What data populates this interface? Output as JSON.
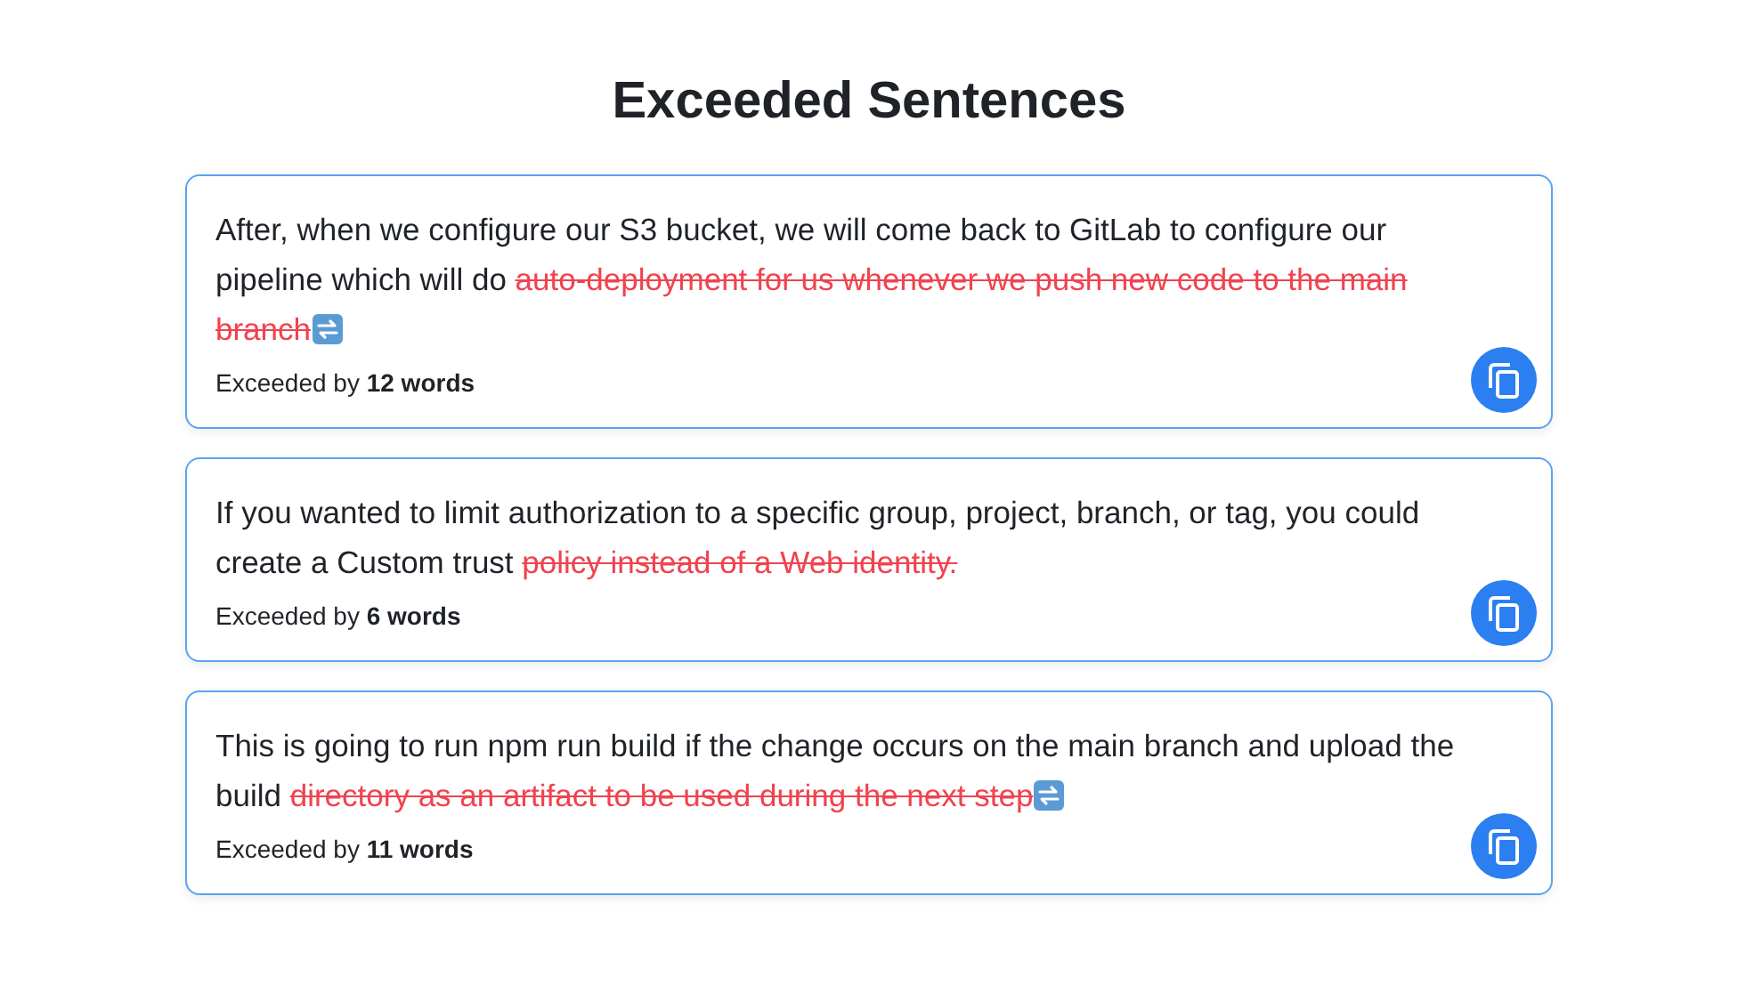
{
  "title": "Exceeded Sentences",
  "sentences": [
    {
      "kept": "After, when we configure our S3 bucket, we will come back to GitLab to configure our pipeline which will do",
      "exceeded": "auto-deployment for us whenever we push new code to the main branch",
      "trailing_icon": true,
      "note": "Exceeded by **12 words**"
    },
    {
      "kept": "If you wanted to limit authorization to a specific group, project, branch, or tag, you could create a Custom trust",
      "exceeded": "policy instead of a Web identity.",
      "trailing_icon": false,
      "note": "Exceeded by **6 words**"
    },
    {
      "kept": "This is going to run npm run build if the change occurs on the main branch and upload the build",
      "exceeded": "directory as an artifact to be used during the next step",
      "trailing_icon": true,
      "note": "Exceeded by **11 words**"
    }
  ]
}
